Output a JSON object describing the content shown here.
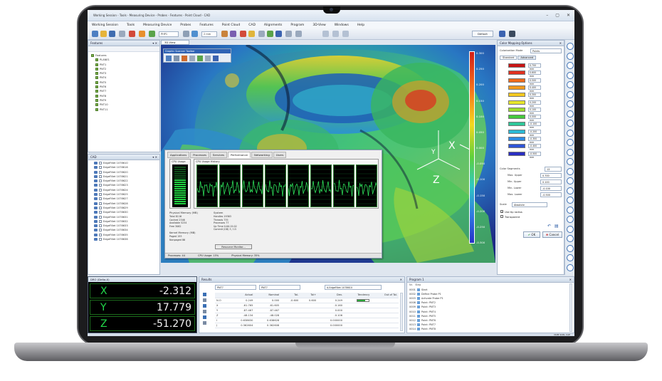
{
  "window": {
    "title": "Working Session - Tools - Measuring Device - Probes - Features - Point Cloud - CAD"
  },
  "menu": [
    "Working Session",
    "Tools",
    "Measuring Device",
    "Probes",
    "Features",
    "Point Cloud",
    "CAD",
    "Alignments",
    "Program",
    "3D-View",
    "Windows",
    "Help"
  ],
  "toolbar": {
    "dropdown1": "PHP1",
    "dropdown2": "2 mm",
    "default_label": "Default"
  },
  "features_panel": {
    "title": "Features",
    "root": "Features",
    "items": [
      "PLANE1",
      "PNT1",
      "PNT2",
      "PNT3",
      "PNT4",
      "PNT5",
      "PNT6",
      "PNT7",
      "PNT8",
      "PNT9",
      "PNT10",
      "PNT11"
    ]
  },
  "cad_panel": {
    "title": "CAD",
    "items": [
      "EdgeFillet 1078610",
      "EdgeFillet 1078616",
      "EdgeFillet 1078620",
      "EdgeFillet 1078621",
      "EdgeFillet 1078622",
      "EdgeFillet 1078623",
      "EdgeFillet 1078624",
      "EdgeFillet 1078625",
      "EdgeFillet 1078627",
      "EdgeFillet 1078628",
      "EdgeFillet 1078629",
      "EdgeFillet 1078630",
      "EdgeFillet 1078631",
      "EdgeFillet 1078632",
      "EdgeFillet 1078633",
      "EdgeFillet 1078634",
      "EdgeFillet 1078635",
      "EdgeFillet 1078636"
    ]
  },
  "view3d": {
    "tab": "3D-View",
    "axes": {
      "x": "X",
      "y": "Y",
      "z": "Z"
    },
    "probe_toolbar_title": "Graphic Scanner Toolbar",
    "scale_labels": [
      "0.300",
      "0.250",
      "0.200",
      "0.150",
      "0.100",
      "0.050",
      "0.000",
      "-0.050",
      "-0.100",
      "-0.150",
      "-0.200",
      "-0.250",
      "-0.300"
    ]
  },
  "task_manager": {
    "tabs": [
      "Applications",
      "Processes",
      "Services",
      "Performance",
      "Networking",
      "Users"
    ],
    "active_tab": "Performance",
    "cpu_usage_caption": "CPU Usage",
    "cpu_history_caption": "CPU Usage History",
    "physical_memory_caption": "Physical Memory (MB)",
    "memory_stats": [
      "Total 8116",
      "Cached 2346",
      "Available 5234",
      "Free 3062"
    ],
    "kernel_caption": "Kernel Memory (MB)",
    "kernel_stats": [
      "Paged 193",
      "Nonpaged 86"
    ],
    "system_caption": "System",
    "system_stats": [
      "Handles 19363",
      "Threads 735",
      "Processes 77",
      "Up Time 0:00:15:02",
      "Commit (GB) 3 / 15"
    ],
    "resource_button": "Resource Monitor...",
    "status": [
      "Processes: 44",
      "CPU Usage: 15%",
      "Physical Memory: 35%"
    ]
  },
  "color_mapping": {
    "title": "Color Mapping Options",
    "mode_label": "Colorization Mode",
    "mode_value": "Points",
    "tabs": [
      "Standard",
      "Advanced"
    ],
    "rows": [
      {
        "color": "#c81414",
        "value": "0.700 mm"
      },
      {
        "color": "#e0301e",
        "value": "0.600 mm"
      },
      {
        "color": "#ef6a1a",
        "value": "0.500 mm"
      },
      {
        "color": "#f29a1c",
        "value": "0.400 mm"
      },
      {
        "color": "#f3c81f",
        "value": "0.300 mm"
      },
      {
        "color": "#e6e52a",
        "value": "0.200 mm"
      },
      {
        "color": "#9fdc2e",
        "value": "0.100 mm"
      },
      {
        "color": "#45c93d",
        "value": "0.000 mm"
      },
      {
        "color": "#2fc79a",
        "value": "-0.100 mm"
      },
      {
        "color": "#2bb9d6",
        "value": "-0.200 mm"
      },
      {
        "color": "#2f8ae0",
        "value": "-0.300 mm"
      },
      {
        "color": "#2f55d8",
        "value": "-0.400 mm"
      },
      {
        "color": "#2a2fc2",
        "value": "-0.500 mm"
      }
    ],
    "segments_label": "Color Segments",
    "segments_value": "13",
    "fields": [
      {
        "label": "Max. Upper",
        "value": "0.700"
      },
      {
        "label": "Min. Upper",
        "value": "0.100"
      },
      {
        "label": "Min. Lower",
        "value": "-0.100"
      },
      {
        "label": "Max. Lower",
        "value": "-0.500"
      }
    ],
    "scale_label": "Scale",
    "scale_value": "Absolute",
    "check1": "Use tip radius",
    "check2": "Transparent",
    "ok_label": "OK",
    "cancel_label": "Cancel"
  },
  "dro": {
    "title": "DRO (Delta-X)",
    "rows": [
      {
        "axis": "X",
        "value": "-2.312"
      },
      {
        "axis": "Y",
        "value": "17.779"
      },
      {
        "axis": "Z",
        "value": "-51.270"
      }
    ]
  },
  "results": {
    "title": "Results",
    "feature_dd": "PNT7",
    "search_dd": "PNT7",
    "fit_label": "A.EdgeFillet 1078610",
    "headers": [
      "",
      "Actual",
      "Nominal",
      "Tol-",
      "Tol+",
      "Dev.",
      "Tendency",
      "Out of Tol."
    ],
    "rows": [
      [
        "N.O",
        "0.249",
        "0.000",
        "-0.600",
        "0.600",
        "0.249",
        "",
        ""
      ],
      [
        "X",
        "-61.765",
        "-61.605",
        "",
        "",
        "-0.160",
        "",
        ""
      ],
      [
        "Y",
        "-87.467",
        "-87.467",
        "",
        "",
        "0.000",
        "",
        ""
      ],
      [
        "Z",
        "-48.134",
        "-48.028",
        "",
        "",
        "-0.106",
        "",
        ""
      ],
      [
        "I",
        "0.638630",
        "0.638628",
        "",
        "",
        "0.000000",
        "",
        ""
      ],
      [
        "J",
        "0.362604",
        "0.362608",
        "",
        "",
        "0.000000",
        "",
        ""
      ]
    ]
  },
  "program": {
    "title": "Program 1",
    "header": [
      "Nr.",
      "Step"
    ],
    "steps": [
      {
        "nr": "0001",
        "text": "Start"
      },
      {
        "nr": "0002",
        "text": "Define Probe P1"
      },
      {
        "nr": "0003",
        "text": "Activate Probe P1"
      },
      {
        "nr": "0008",
        "text": "Point: PNT2"
      },
      {
        "nr": "0009",
        "text": "Point: PNT3"
      },
      {
        "nr": "0010",
        "text": "Point: PNT4"
      },
      {
        "nr": "0011",
        "text": "Point: PNT5"
      },
      {
        "nr": "0012",
        "text": "Point: PNT6"
      },
      {
        "nr": "0013",
        "text": "Point: PNT7"
      },
      {
        "nr": "0014",
        "text": "Point: PNT8"
      }
    ]
  },
  "status": {
    "right": "NUM SCRL CAP"
  }
}
